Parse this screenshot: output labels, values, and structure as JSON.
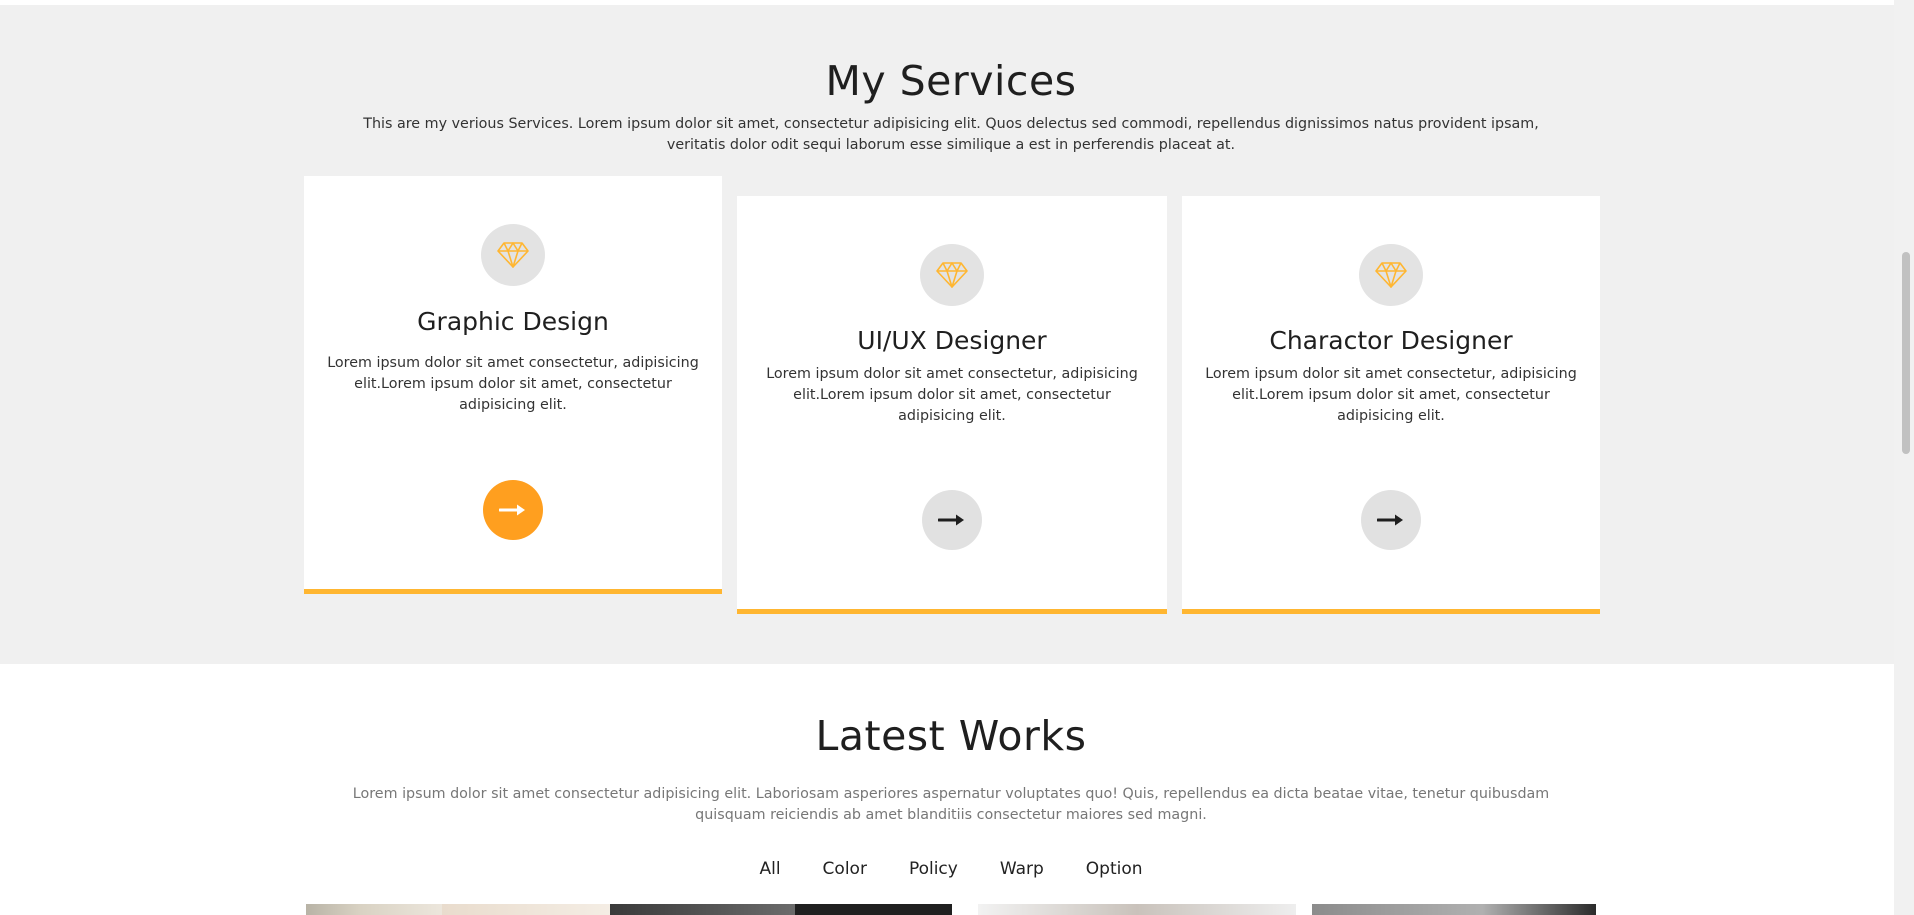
{
  "services": {
    "title": "My Services",
    "description": "This are my verious Services. Lorem ipsum dolor sit amet, consectetur adipisicing elit. Quos delectus sed commodi, repellendus dignissimos natus provident ipsam, veritatis dolor odit sequi laborum esse similique a est in perferendis placeat at.",
    "cards": [
      {
        "title": "Graphic Design",
        "text": "Lorem ipsum dolor sit amet consectetur, adipisicing elit.Lorem ipsum dolor sit amet, consectetur adipisicing elit.",
        "icon": "diamond-icon",
        "button_icon": "arrow-right-icon"
      },
      {
        "title": "UI/UX Designer",
        "text": "Lorem ipsum dolor sit amet consectetur, adipisicing elit.Lorem ipsum dolor sit amet, consectetur adipisicing elit.",
        "icon": "diamond-icon",
        "button_icon": "arrow-right-icon"
      },
      {
        "title": "Charactor Designer",
        "text": "Lorem ipsum dolor sit amet consectetur, adipisicing elit.Lorem ipsum dolor sit amet, consectetur adipisicing elit.",
        "icon": "diamond-icon",
        "button_icon": "arrow-right-icon"
      }
    ]
  },
  "works": {
    "title": "Latest Works",
    "description": "Lorem ipsum dolor sit amet consectetur adipisicing elit. Laboriosam asperiores aspernatur voluptates quo! Quis, repellendus ea dicta beatae vitae, tenetur quibusdam quisquam reiciendis ab amet blanditiis consectetur maiores sed magni.",
    "filters": [
      "All",
      "Color",
      "Policy",
      "Warp",
      "Option"
    ]
  },
  "colors": {
    "accent": "#ffb631",
    "active_button": "#ff9f1f",
    "section_bg": "#f0f0f0"
  }
}
